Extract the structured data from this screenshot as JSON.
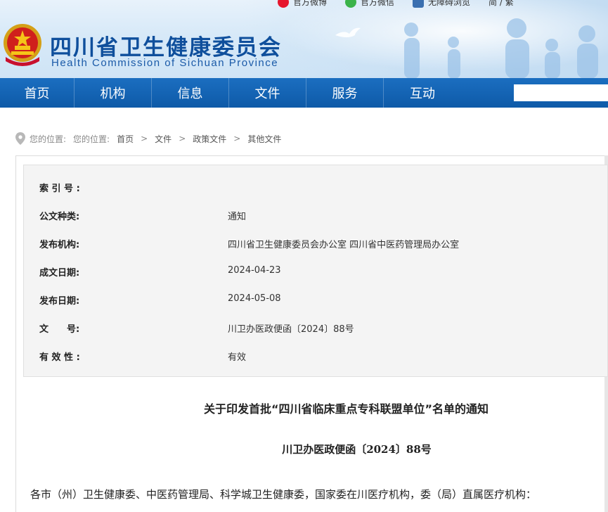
{
  "header": {
    "title_cn": "四川省卫生健康委员会",
    "title_en": "Health Commission of Sichuan Province",
    "top_links": [
      "官方微博",
      "官方微信",
      "无障碍浏览",
      "简 / 繁"
    ]
  },
  "nav": {
    "items": [
      "首页",
      "机构",
      "信息",
      "文件",
      "服务",
      "互动"
    ],
    "search_placeholder": ""
  },
  "breadcrumb": {
    "label1": "您的位置:",
    "label2": "您的位置:",
    "items": [
      "首页",
      "文件",
      "政策文件",
      "其他文件"
    ],
    "separator": ">"
  },
  "info": {
    "rows": [
      {
        "key": "索 引 号 :",
        "value": ""
      },
      {
        "key": "公文种类:",
        "value": "通知"
      },
      {
        "key": "发布机构:",
        "value": "四川省卫生健康委员会办公室 四川省中医药管理局办公室"
      },
      {
        "key": "成文日期:",
        "value": "2024-04-23"
      },
      {
        "key": "发布日期:",
        "value": "2024-05-08"
      },
      {
        "key": "文　　号:",
        "value": "川卫办医政便函〔2024〕88号"
      },
      {
        "key": "有 效 性 :",
        "value": "有效"
      }
    ]
  },
  "document": {
    "title": "关于印发首批“四川省临床重点专科联盟单位”名单的通知",
    "number": "川卫办医政便函〔2024〕88号",
    "salutation": "各市（州）卫生健康委、中医药管理局、科学城卫生健康委，国家委在川医疗机构，委（局）直属医疗机构："
  },
  "colors": {
    "nav_blue": "#0e5aa8",
    "title_blue": "#0f4f9c",
    "info_bg": "#f4f4f4"
  }
}
